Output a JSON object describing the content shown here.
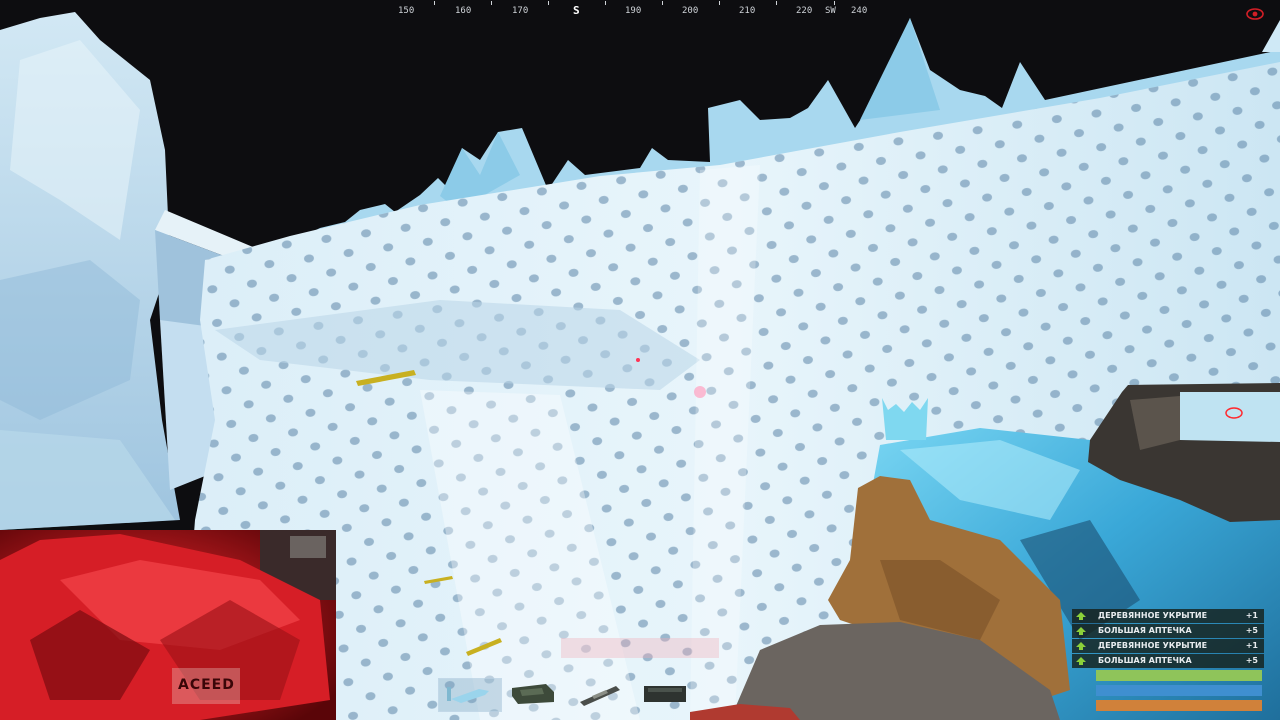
{
  "compass": {
    "ticks": [
      "150",
      "160",
      "170",
      "S",
      "190",
      "200",
      "210",
      "220",
      "SW",
      "240"
    ]
  },
  "hud": {
    "eye_icon": "eye-icon",
    "crosshair": "crosshair-dot"
  },
  "webcam": {
    "sign_text": "ACEED"
  },
  "hotbar": {
    "slots": [
      "rifle-icon",
      "ammo-box-icon",
      "ammo-icon",
      "box-icon"
    ],
    "active_slot": 0
  },
  "item_feed": [
    {
      "name": "ДЕРЕВЯННОЕ УКРЫТИЕ",
      "count": "+1"
    },
    {
      "name": "БОЛЬШАЯ АПТЕЧКА",
      "count": "+5"
    },
    {
      "name": "ДЕРЕВЯННОЕ УКРЫТИЕ",
      "count": "+1"
    },
    {
      "name": "БОЛЬШАЯ АПТЕЧКА",
      "count": "+5"
    }
  ],
  "status_bars": [
    {
      "name": "health",
      "fill": 1.0,
      "color": "#8fc45a"
    },
    {
      "name": "hydration",
      "fill": 1.0,
      "color": "#3f8fd0"
    },
    {
      "name": "food",
      "fill": 1.0,
      "color": "#d0813a"
    }
  ],
  "colors": {
    "sky": "#0d0d10",
    "ice": "#bfe0f0",
    "webcam_tint": "#c41a20",
    "feed_plus": "#8bd13a"
  }
}
